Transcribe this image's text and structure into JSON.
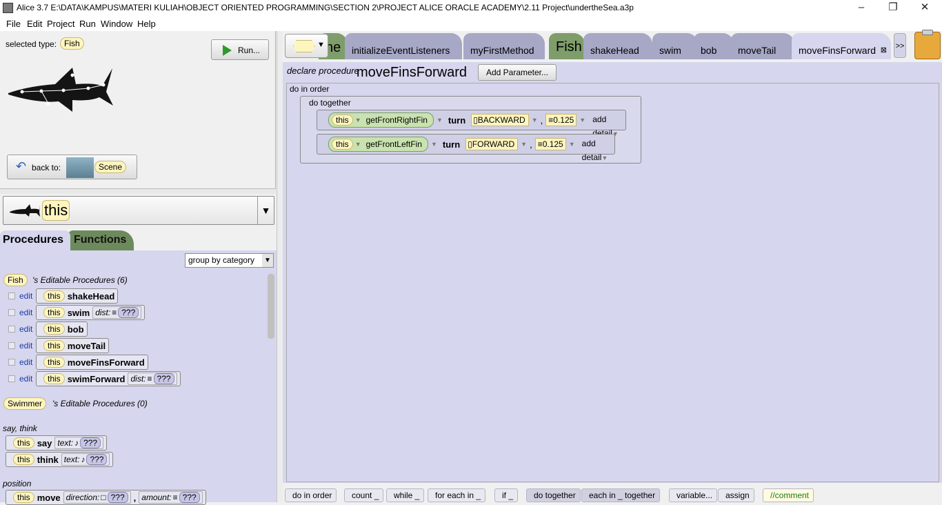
{
  "window": {
    "title": "Alice 3.7 E:\\DATA\\KAMPUS\\MATERI KULIAH\\OBJECT ORIENTED PROGRAMMING\\SECTION 2\\PROJECT ALICE ORACLE ACADEMY\\2.11 Project\\undertheSea.a3p",
    "minimize": "–",
    "maximize": "❐",
    "close": "✕"
  },
  "menu": [
    "File",
    "Edit",
    "Project",
    "Run",
    "Window",
    "Help"
  ],
  "scene_panel": {
    "selected_type_label": "selected type:",
    "selected_type": "Fish",
    "run_label": "Run...",
    "back_to_label": "back to:",
    "back_to_target": "Scene"
  },
  "object_selector": {
    "value": "this"
  },
  "procedure_tabs": {
    "procedures": "Procedures",
    "functions": "Functions"
  },
  "group_select": {
    "value": "group by category"
  },
  "fish_section": {
    "type": "Fish",
    "header": "'s Editable Procedures (6)",
    "edit_label": "edit",
    "this_label": "this",
    "items": [
      {
        "name": "shakeHead"
      },
      {
        "name": "swim",
        "param": "dist:",
        "value": "???"
      },
      {
        "name": "bob"
      },
      {
        "name": "moveTail"
      },
      {
        "name": "moveFinsForward"
      },
      {
        "name": "swimForward",
        "param": "dist:",
        "value": "???"
      }
    ]
  },
  "swimmer_section": {
    "type": "Swimmer",
    "header": "'s Editable Procedures (0)"
  },
  "say_think": {
    "category": "say, think",
    "items": [
      {
        "name": "say",
        "param": "text:",
        "value": "???"
      },
      {
        "name": "think",
        "param": "text:",
        "value": "???"
      }
    ]
  },
  "position": {
    "category": "position",
    "name": "move",
    "param1": "direction:",
    "value1": "???",
    "sep": ",",
    "param2": "amount:",
    "value2": "???"
  },
  "editor_tabs": {
    "partial": "ne",
    "tabs": [
      "initializeEventListeners",
      "myFirstMethod"
    ],
    "type": "Fish",
    "type_tabs": [
      "shakeHead",
      "swim",
      "bob",
      "moveTail"
    ],
    "active": "moveFinsForward",
    "overflow": ">>"
  },
  "editor": {
    "declare_label": "declare procedure",
    "procedure_name": "moveFinsForward",
    "add_parameter": "Add Parameter...",
    "do_in_order": "do in order",
    "do_together": "do together",
    "statements": [
      {
        "target": "this",
        "getter": "getFrontRightFin",
        "verb": "turn",
        "direction": "BACKWARD",
        "amount": "0.125",
        "detail": "add detail"
      },
      {
        "target": "this",
        "getter": "getFrontLeftFin",
        "verb": "turn",
        "direction": "FORWARD",
        "amount": "0.125",
        "detail": "add detail"
      }
    ]
  },
  "control_bar": [
    "do in order",
    "count _",
    "while _",
    "for each in _",
    "if _",
    "do together",
    "each in _ together",
    "variable...",
    "assign",
    "//comment"
  ]
}
